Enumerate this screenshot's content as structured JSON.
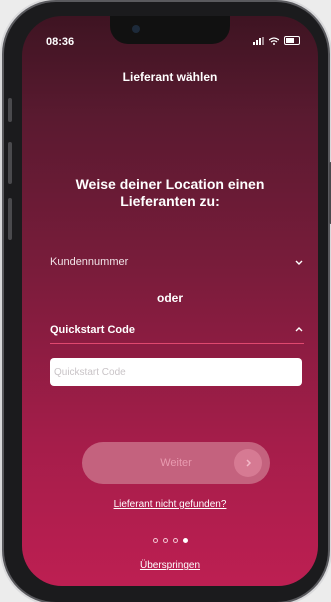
{
  "status": {
    "time": "08:36"
  },
  "nav": {
    "title": "Lieferant wählen"
  },
  "main": {
    "heading": "Weise deiner Location einen Lieferanten zu:",
    "kundennummer_label": "Kundennummer",
    "separator": "oder",
    "quickstart_label": "Quickstart Code",
    "quickstart_input": {
      "value": "",
      "placeholder": "Quickstart Code"
    },
    "continue_label": "Weiter",
    "not_found_link": "Lieferant nicht gefunden?",
    "pagination": {
      "total": 4,
      "active": 4
    },
    "skip_link": "Überspringen"
  },
  "colors": {
    "accent": "#bd1f52",
    "button": "#c4627e",
    "underline": "#e0486f"
  }
}
